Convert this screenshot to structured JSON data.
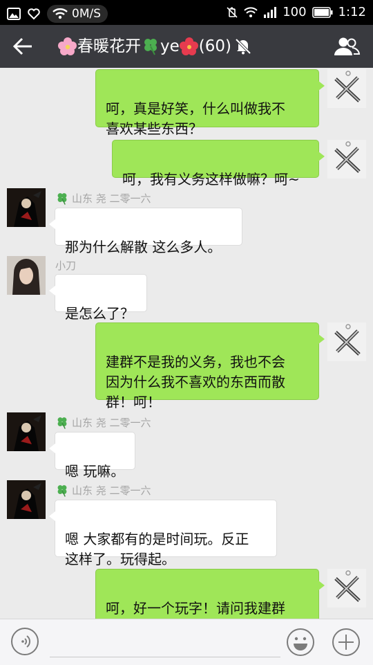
{
  "status_bar": {
    "net_speed": "0M/S",
    "battery": "100",
    "time": "1:12"
  },
  "header": {
    "title_part1": "春暖花开",
    "title_part2": "ye",
    "title_count": "(60)",
    "icons": [
      "back-arrow-icon",
      "flower-icon",
      "clover-icon",
      "flower-icon",
      "mute-bell-icon",
      "group-members-icon"
    ]
  },
  "messages": [
    {
      "dir": "out",
      "text": "呵，真是好笑，什么叫做我不\n喜欢某些东西？"
    },
    {
      "dir": "out",
      "text": "呵，我有义务这样做嘛？呵~"
    },
    {
      "dir": "in",
      "sender": "山东 尧 二零一六",
      "text": "那为什么解散 这么多人。"
    },
    {
      "dir": "in",
      "sender": "小刀",
      "text": "是怎么了？"
    },
    {
      "dir": "out",
      "text": "建群不是我的义务，我也不会\n因为什么我不喜欢的东西而散\n群！呵！"
    },
    {
      "dir": "in",
      "sender": "山东 尧 二零一六",
      "text": "嗯 玩嘛。"
    },
    {
      "dir": "in",
      "sender": "山东 尧 二零一六",
      "text": "嗯 大家都有的是时间玩。反正\n这样了。玩得起。"
    },
    {
      "dir": "out",
      "text": "呵，好一个玩字！请问我建群\n我在群里怎么玩了嗯？"
    }
  ],
  "input_bar": {
    "placeholder": "",
    "icons": [
      "voice-icon",
      "emoji-icon",
      "plus-icon"
    ]
  },
  "colors": {
    "outgoing_bubble": "#9fe658",
    "incoming_bubble": "#ffffff",
    "title_bar": "#393a3f",
    "chat_bg": "#ebebeb"
  }
}
